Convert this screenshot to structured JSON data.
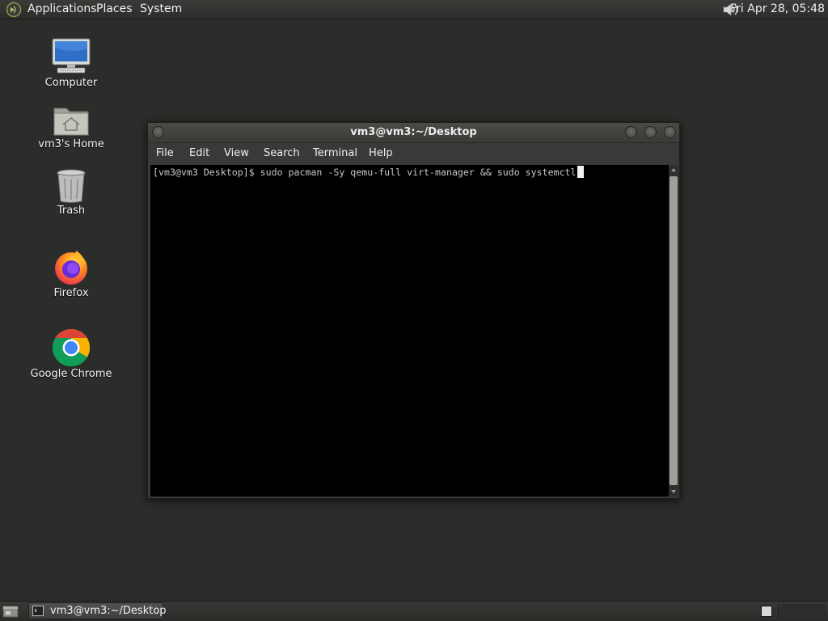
{
  "top_panel": {
    "menus": [
      "Applications",
      "Places",
      "System"
    ],
    "clock": "Fri Apr 28, 05:48"
  },
  "desktop": {
    "icons": [
      {
        "label": "Computer",
        "icon": "computer-icon"
      },
      {
        "label": "vm3's Home",
        "icon": "home-folder-icon"
      },
      {
        "label": "Trash",
        "icon": "trash-icon"
      },
      {
        "label": "Firefox",
        "icon": "firefox-icon"
      },
      {
        "label": "Google Chrome",
        "icon": "chrome-icon"
      }
    ]
  },
  "terminal": {
    "title": "vm3@vm3:~/Desktop",
    "menus": [
      "File",
      "Edit",
      "View",
      "Search",
      "Terminal",
      "Help"
    ],
    "prompt": "[vm3@vm3 Desktop]$ ",
    "command": "sudo pacman -Sy qemu-full virt-manager && sudo systemctl"
  },
  "bottom_panel": {
    "task_label": "vm3@vm3:~/Desktop"
  },
  "colors": {
    "desktop_bg": "#2b2d2a",
    "panel_bg": "#2c2d2a",
    "terminal_bg": "#000000",
    "terminal_fg": "#c8c8c8"
  }
}
